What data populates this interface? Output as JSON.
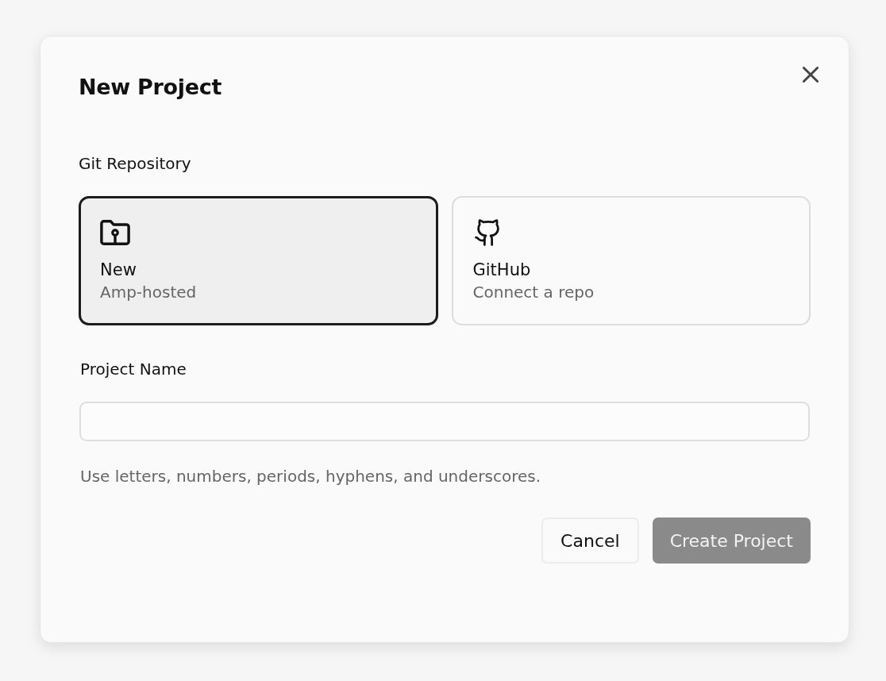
{
  "dialog": {
    "title": "New Project"
  },
  "repository": {
    "label": "Git Repository",
    "options": [
      {
        "kind": "folder",
        "title": "New",
        "subtitle": "Amp-hosted",
        "selected": true
      },
      {
        "kind": "github",
        "title": "GitHub",
        "subtitle": "Connect a repo",
        "selected": false
      }
    ]
  },
  "project_name": {
    "label": "Project Name",
    "hint": "Use letters, numbers, periods, hyphens, and underscores."
  },
  "buttons": [
    {
      "kind": "secondary",
      "label": "Cancel",
      "disabled": false
    },
    {
      "kind": "primary",
      "label": "Create Project",
      "disabled": true
    }
  ]
}
